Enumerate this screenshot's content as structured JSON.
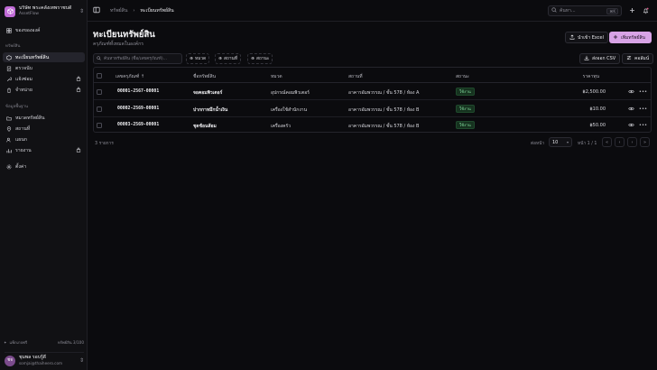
{
  "org": {
    "name": "บริษัท พระคลังเทพราชบดี",
    "sub": "AssetFlow",
    "logo_icon": "box-icon"
  },
  "sidebar": {
    "top_item": "ของขององค์",
    "group1": "ทรัพย์สิน",
    "items1": [
      "ทะเบียนทรัพย์สิน",
      "ตรวจนับ",
      "แจ้งซ่อม",
      "จำหน่าย"
    ],
    "group2": "ข้อมูลพื้นฐาน",
    "items2": [
      "หมวดทรัพย์สิน",
      "สถานที่",
      "แผนก",
      "รายงาน"
    ],
    "settings": "ตั้งค่า",
    "bottom_left": "แพ็กเกจฟรี",
    "bottom_right": "ทรัพย์สิน 3/100"
  },
  "user": {
    "initials": "ชจ",
    "name": "ชุมพล รอบรู้ดี",
    "email": "somjai@thaiheero.com"
  },
  "topbar": {
    "crumb_root": "ทรัพย์สิน",
    "crumb_current": "ทะเบียนทรัพย์สิน",
    "search_placeholder": "ค้นหา...",
    "search_kbd": "⌘K"
  },
  "page": {
    "title": "ทะเบียนทรัพย์สิน",
    "subtitle": "ครุภัณฑ์ทั้งหมดในองค์กร",
    "import_label": "นำเข้า Excel",
    "add_label": "เพิ่มทรัพย์สิน",
    "filter_placeholder": "ค้นหาทรัพย์สิน (ชื่อ/เลขครุภัณฑ์)...",
    "chip_category": "หมวด",
    "chip_location": "สถานที่",
    "chip_status": "สถานะ",
    "export_label": "ส่งออก CSV",
    "columns_label": "คอลัมน์"
  },
  "table": {
    "headers": [
      "เลขครุภัณฑ์",
      "ชื่อทรัพย์สิน",
      "หมวด",
      "สถานที่",
      "สถานะ",
      "ราคาทุน"
    ],
    "sort_indicator": "↑",
    "rows": [
      {
        "code": "00001-2567-00001",
        "name": "จอคอมพิวเตอร์",
        "category": "อุปกรณ์คอมพิวเตอร์",
        "location": "อาคารอัมพวรรณ / ชั้น 578 / ห้อง A",
        "status": "ใช้งาน",
        "price": "฿2,500.00"
      },
      {
        "code": "00002-2569-00001",
        "name": "ปากกาหมึกน้ำเงิน",
        "category": "เครื่องใช้สำนักงาน",
        "location": "อาคารอัมพวรรณ / ชั้น 578 / ห้อง B",
        "status": "ใช้งาน",
        "price": "฿10.00"
      },
      {
        "code": "00003-2569-00001",
        "name": "ชุดช้อนส้อม",
        "category": "เครื่องครัว",
        "location": "อาคารอัมพวรรณ / ชั้น 578 / ห้อง B",
        "status": "ใช้งาน",
        "price": "฿50.00"
      }
    ]
  },
  "pagination": {
    "count": "3 รายการ",
    "rows_label": "ต่อหน้า",
    "rows_value": "10",
    "page_label": "หน้า 1 / 1"
  },
  "colors": {
    "accent": "#d8a3e6",
    "status_ok": "#7fd89b"
  }
}
